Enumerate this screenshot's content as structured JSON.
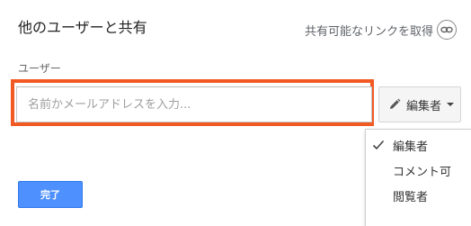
{
  "dialog": {
    "title": "他のユーザーと共有",
    "share_link_label": "共有可能なリンクを取得",
    "share_link_icon": "link-icon"
  },
  "users": {
    "label": "ユーザー",
    "input_value": "",
    "input_placeholder": "名前かメールアドレスを入力..."
  },
  "permission": {
    "selected_label": "編集者",
    "icon": "pencil-icon",
    "options": [
      {
        "label": "編集者",
        "checked": true
      },
      {
        "label": "コメント可",
        "checked": false
      },
      {
        "label": "閲覧者",
        "checked": false
      }
    ]
  },
  "footer": {
    "done_label": "完了"
  },
  "colors": {
    "highlight_border": "#f15a24",
    "primary_button": "#4d90fe"
  }
}
